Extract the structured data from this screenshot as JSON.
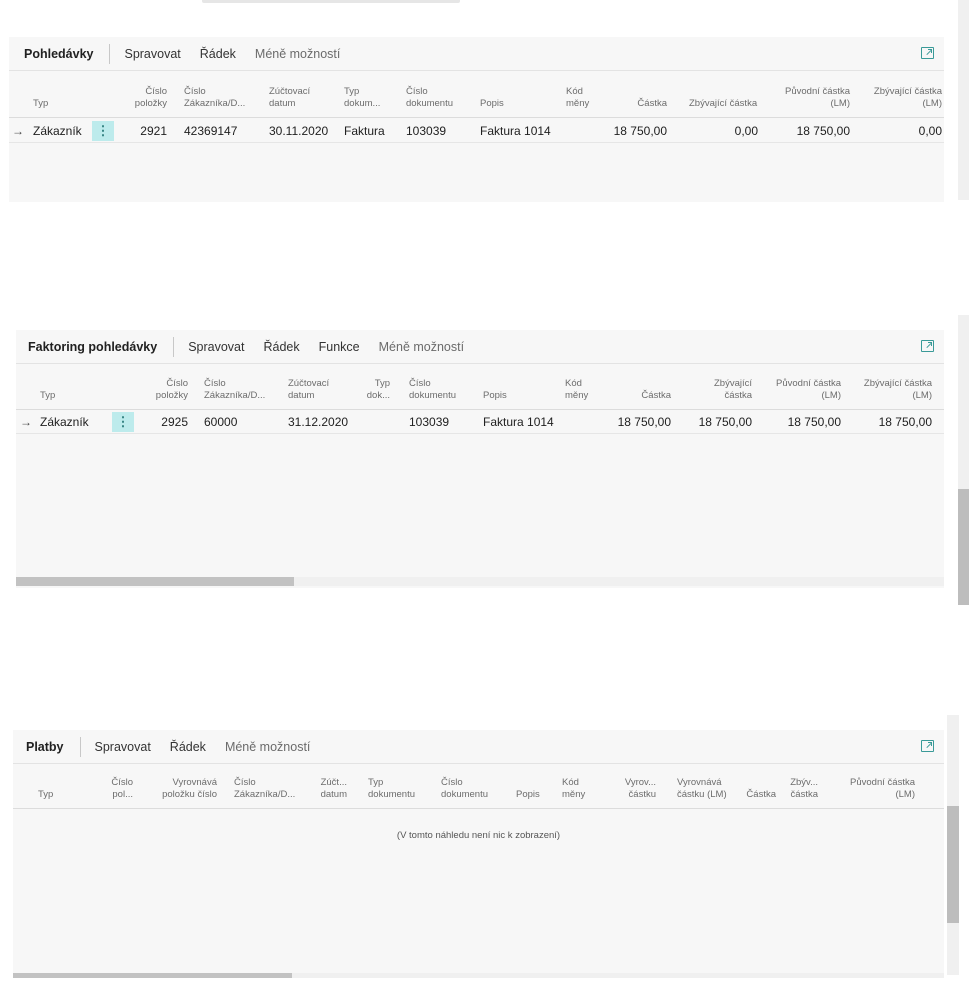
{
  "parts": [
    {
      "title": "Pohledávky",
      "actions": [
        "Spravovat",
        "Řádek"
      ],
      "less": "Méně možností",
      "headers": {
        "typ": "Typ",
        "cislo_polozky": [
          "Číslo",
          "položky"
        ],
        "cislo_zakaznika": [
          "Číslo",
          "Zákazníka/D..."
        ],
        "zuctovaci_datum": [
          "Zúčtovací",
          "datum"
        ],
        "typ_dokumentu": [
          "Typ",
          "dokum..."
        ],
        "cislo_dokumentu": [
          "Číslo",
          "dokumentu"
        ],
        "popis": "Popis",
        "kod_meny": [
          "Kód",
          "měny"
        ],
        "castka": "Částka",
        "zbyvajici_castka": "Zbývající částka",
        "puvodni_castka_lm": [
          "Původní částka",
          "(LM)"
        ],
        "zbyvajici_castka_lm": [
          "Zbývající částka",
          "(LM)"
        ]
      },
      "row": {
        "arrow": "→",
        "typ": "Zákazník",
        "menu": "⋮",
        "cislo_polozky": "2921",
        "cislo_zakaznika": "42369147",
        "zuctovaci_datum": "30.11.2020",
        "typ_dokumentu": "Faktura",
        "cislo_dokumentu": "103039",
        "popis": "Faktura 1014",
        "kod_meny": "",
        "castka": "18 750,00",
        "zbyvajici_castka": "0,00",
        "puvodni_castka_lm": "18 750,00",
        "zbyvajici_castka_lm": "0,00"
      }
    },
    {
      "title": "Faktoring pohledávky",
      "actions": [
        "Spravovat",
        "Řádek",
        "Funkce"
      ],
      "less": "Méně možností",
      "headers": {
        "typ": "Typ",
        "cislo_polozky": [
          "Číslo",
          "položky"
        ],
        "cislo_zakaznika": [
          "Číslo",
          "Zákazníka/D..."
        ],
        "zuctovaci_datum": [
          "Zúčtovací",
          "datum"
        ],
        "typ_dokumentu": [
          "Typ",
          "dok..."
        ],
        "cislo_dokumentu": [
          "Číslo",
          "dokumentu"
        ],
        "popis": "Popis",
        "kod_meny": [
          "Kód",
          "měny"
        ],
        "castka": "Částka",
        "zbyvajici_castka": [
          "Zbývající",
          "částka"
        ],
        "puvodni_castka_lm": [
          "Původní částka",
          "(LM)"
        ],
        "zbyvajici_castka_lm": [
          "Zbývající částka",
          "(LM)"
        ]
      },
      "row": {
        "arrow": "→",
        "typ": "Zákazník",
        "menu": "⋮",
        "cislo_polozky": "2925",
        "cislo_zakaznika": "60000",
        "zuctovaci_datum": "31.12.2020",
        "typ_dokumentu": "",
        "cislo_dokumentu": "103039",
        "popis": "Faktura 1014",
        "kod_meny": "",
        "castka": "18 750,00",
        "zbyvajici_castka": "18 750,00",
        "puvodni_castka_lm": "18 750,00",
        "zbyvajici_castka_lm": "18 750,00"
      }
    },
    {
      "title": "Platby",
      "actions": [
        "Spravovat",
        "Řádek"
      ],
      "less": "Méně možností",
      "headers": {
        "typ": "Typ",
        "cislo_polozky": [
          "Číslo",
          "pol..."
        ],
        "vyrovnava_polozku": [
          "Vyrovnává",
          "položku číslo"
        ],
        "cislo_zakaznika": [
          "Číslo",
          "Zákazníka/D..."
        ],
        "zuctovaci_datum": [
          "Zúčt...",
          "datum"
        ],
        "typ_dokumentu": [
          "Typ",
          "dokumentu"
        ],
        "cislo_dokumentu": [
          "Číslo",
          "dokumentu"
        ],
        "popis": "Popis",
        "kod_meny": [
          "Kód",
          "měny"
        ],
        "vyrovnava_castku": [
          "Vyrov...",
          "částku"
        ],
        "vyrovnava_castku_lm": [
          "Vyrovnává",
          "částku (LM)"
        ],
        "castka": "Částka",
        "zbyvajici_castka": [
          "Zbýv...",
          "částka"
        ],
        "puvodni_castka_lm": [
          "Původní částka",
          "(LM)"
        ]
      },
      "empty_text": "(V tomto náhledu není nic k zobrazení)"
    }
  ],
  "colors": {
    "accent": "#3a9a98",
    "row_menu_bg": "#bdebec",
    "part_bg": "#f7f7f7"
  },
  "scrollbars": {
    "part2_horizontal_fraction": 0.3,
    "part3_horizontal_fraction": 0.3,
    "page_vertical_fraction": 0.45
  }
}
